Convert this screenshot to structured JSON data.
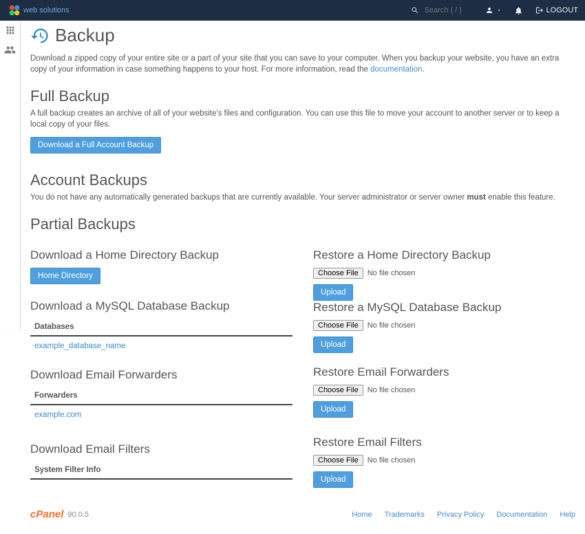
{
  "topbar": {
    "search_placeholder": "Search ( / )",
    "logout": "LOGOUT"
  },
  "page": {
    "title": "Backup",
    "intro_a": "Download a zipped copy of your entire site or a part of your site that you can save to your computer. When you backup your website, you have an extra copy of your information in case something happens to your host. For more information, read the ",
    "doc_link": "documentation",
    "intro_b": "."
  },
  "full": {
    "heading": "Full Backup",
    "desc": "A full backup creates an archive of all of your website's files and configuration. You can use this file to move your account to another server or to keep a local copy of your files.",
    "button": "Download a Full Account Backup"
  },
  "account": {
    "heading": "Account Backups",
    "desc_a": "You do not have any automatically generated backups that are currently available. Your server administrator or server owner ",
    "must": "must",
    "desc_b": " enable this feature."
  },
  "partial": {
    "heading": "Partial Backups"
  },
  "dl": {
    "home_h": "Download a Home Directory Backup",
    "home_btn": "Home Directory",
    "mysql_h": "Download a MySQL Database Backup",
    "db_th": "Databases",
    "db_row": "example_database_name",
    "fwd_h": "Download Email Forwarders",
    "fwd_th": "Forwarders",
    "fwd_row": "example.com",
    "flt_h": "Download Email Filters",
    "flt_th": "System Filter Info"
  },
  "rs": {
    "home_h": "Restore a Home Directory Backup",
    "mysql_h": "Restore a MySQL Database Backup",
    "fwd_h": "Restore Email Forwarders",
    "flt_h": "Restore Email Filters",
    "choose": "Choose File",
    "nofile": "No file chosen",
    "upload": "Upload"
  },
  "footer": {
    "brand": "cPanel",
    "version": "90.0.5",
    "links": {
      "home": "Home",
      "tm": "Trademarks",
      "pp": "Privacy Policy",
      "doc": "Documentation",
      "help": "Help"
    }
  }
}
